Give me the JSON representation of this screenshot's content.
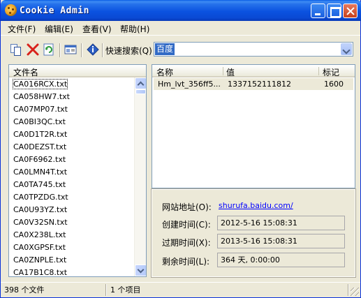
{
  "window": {
    "title": "Cookie Admin"
  },
  "menu": [
    {
      "label": "文件(F)"
    },
    {
      "label": "编辑(E)"
    },
    {
      "label": "查看(V)"
    },
    {
      "label": "帮助(H)"
    }
  ],
  "toolbar": {
    "quick_search_label": "快速搜索(Q)",
    "search_value": "百度",
    "icons": [
      "copy-icon",
      "delete-icon",
      "refresh-icon",
      "properties-icon",
      "info-icon"
    ]
  },
  "file_list": {
    "header": "文件名",
    "items": [
      "CA016RCX.txt",
      "CA058HW7.txt",
      "CA07MP07.txt",
      "CA0BI3QC.txt",
      "CA0D1T2R.txt",
      "CA0DEZST.txt",
      "CA0F6962.txt",
      "CA0LMN4T.txt",
      "CA0TA745.txt",
      "CA0TPZDG.txt",
      "CA0U93YZ.txt",
      "CA0V32SN.txt",
      "CA0X238L.txt",
      "CA0XGPSF.txt",
      "CA0ZNPLE.txt",
      "CA17B1C8.txt"
    ],
    "selected_index": 0
  },
  "cookie_table": {
    "columns": [
      "名称",
      "值",
      "标记"
    ],
    "rows": [
      {
        "name": "Hm_lvt_356ff5...",
        "value": "1337152111812",
        "flag": "1600"
      }
    ]
  },
  "details": {
    "site_label": "网站地址(O):",
    "site_url": "shurufa.baidu.com/",
    "created_label": "创建时间(C):",
    "created_value": "2012-5-16 15:08:31",
    "expires_label": "过期时间(X):",
    "expires_value": "2013-5-16 15:08:31",
    "remaining_label": "剩余时间(L):",
    "remaining_value": "364 天, 0:00:00"
  },
  "status": {
    "file_count": "398 个文件",
    "item_count": "1 个项目"
  }
}
